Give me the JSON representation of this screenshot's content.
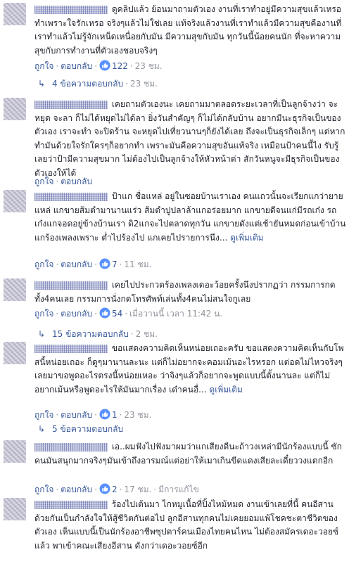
{
  "colors": {
    "link": "#385898",
    "meta": "#90949c",
    "like_badge": "#5890ff",
    "text": "#1d2129"
  },
  "icons": {
    "reaction": "like-icon",
    "replies": "reply-arrow-icon"
  },
  "labels": {
    "like": "ถูกใจ",
    "reply": "ตอบกลับ",
    "dot": "·",
    "see_more": "ดูเพิ่มเติม"
  },
  "comments": [
    {
      "text": "ดูคลิปแล้ว ย้อนมาถามตัวเอง งานที่เราทำอยู่มีความสุขแล้วเหรอ ทำเพราะใจรักเหรอ จริงๆแล้วไม่ใช่เลย แท้จริงแล้วงานที่เราทำแล้วมีความสุขคืองานที่เราทำแล้วไม่รู้จักเหน็ดเหนื่อยกับมัน มีความสุขกับมัน ทุกวันนี้น้อยคนนัก ที่จะหาความสุขกับการทำงานที่ตัวเองชอบจริงๆ",
      "likes": "122",
      "time": "23 ชม.",
      "replies": {
        "label": "4 ข้อความตอบกลับ",
        "time": "23 ชม."
      }
    },
    {
      "text": "เคยถามตัวเองนะ เคยถามมาตลอดระยะเวลาที่เป็นลูกจ้างว่า จะหยุด จะลา ก็ไม่ได้หยุดไม่ได้ลา ยิ่งวันสำคัญๆ ก็ไม่ได้กลับบ้าน อยากมีนะธุรกิจเป็นของตัวเอง เราจะทำ จะปิดร้าน จะหยุดไปเที่ยวนานๆก็ยังได้เลย ถึงจะเป็นธุรกิจเล็กๆ แต่หากทำมันด้วยใจรักใครๆก็อยากทำ เพราะมันคือความสุขอันแท้จริง เหมือนป้าคนนี้ไง รับรู้เลยว่าป้ามีความสุขมาก ไม่ต้องไปเป็นลูกจ้างให้หัวหน้าด่า สักวันหนูจะมีธุรกิจเป็นของตัวเองให้ได้",
      "likes": "",
      "time": "",
      "replies": null
    },
    {
      "text": "ป้าแก ชื่อแหล่ อยู่ในซอยบ้านเราเอง คนแถวนั้นจะเรียกแกว่ายายแหล่ แกขายส้มตำมานานแร่ว ส้มตำปูปลาล้าแกอร่อยมาก แกขายดีจนแก่มีรถเก๋ง รถเก๋งแกจอดอยู่ข้างบ้านเรา ดิ2แกจะไปตลาดทุกวัน แกขายดังแต่เช้ายันหมดก่อนเข้าบ้าน แกร้องเพลงเพราะ ต่ำไปร้องไป แกเคยไปรายการนึง...",
      "see_more": true,
      "likes": "7",
      "time": "11 ชม.",
      "replies": null
    },
    {
      "text": "เคยไปประกวดร้องเพลงเดอะว้อยครั้งนึงปรากฏว่า กรรมการกดทั้ง4คนเลย กรรมการนั่งกดโทรศัพท์เล่นทั้ง4คนไม่สนใจกูเลย",
      "likes": "54",
      "time": "เมื่อวานนี้ เวลา 11:42 น.",
      "replies": {
        "label": "15 ข้อความตอบกลับ",
        "time": "2 ชม."
      }
    },
    {
      "text": "ขอแสดงความคิดเห็นหน่อยเถอะครับ ขอแสดงความคิดเห็นกับโพสนี้หน่อยเถอะ ก็ดูๆมานานละนะ แต่ก็ไม่อยากจะคอมเม้นอะไรหรอก แต่อดไม่ไหวจริงๆ เลยมาขอพูดอะไรตรงนี้หน่อยเหอะ ว่าจิงๆแล้วก็อยากจะพูดแบบนี้ตั้งนานละ แต่ก็ไม่อยากเม้นหรือพูดอะไรให้มันมากเรื่อง เด๋าคนอื่...",
      "see_more": true,
      "likes": "1",
      "time": "23 ชม.",
      "replies": {
        "label": "5 ข้อความตอบกลับ",
        "time": ""
      }
    },
    {
      "text": "เอ..ผมฟังไปฟังมาผมว่าแกเสียงดีนะถ้าวงเหล่ามีนักร้องแบบนี้ ซักคนมันสนุกมากจริงๆมันเข้าถึงอารมณ์แต่อย่าให้เมาเกินขีดแดงเสียละเดี๋ยววงแตกอีก",
      "likes": "2",
      "time": "17 ชม.",
      "edited": "มีการแก้ไข",
      "replies": null
    },
    {
      "text": "ร้องไปเต้นมา ไกหมูเนื้อที่ปิ้งไหม้หมด งานเข้าเลยที่นี้ คนอีสานด้วยกันเป็นกำลังใจให้สู้ชีวิตกันต่อไป ลูกอีสานทุกคนไม่เคยยอมแพ้โชคชะตาชีวิตของตัวเอง เห็นแบบนี้เป็นนักร้องอาชีพซุปตาร์คนเมืองไทยคนไหน ไม่ต้องสมัครเดอะวอยซ์แล้ว พาเข้าคณะเสียงอีสาน ดังกว่าเดอะวอยซ์อีก",
      "likes": "",
      "time": "",
      "replies": null
    }
  ]
}
